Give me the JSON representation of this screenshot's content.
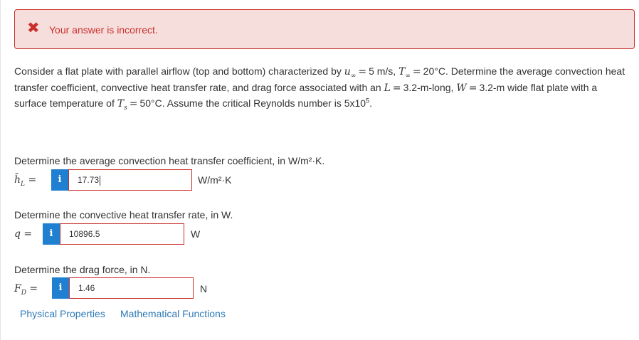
{
  "alert": {
    "icon": "x-icon",
    "message": "Your answer is incorrect.",
    "color": "#c9302c"
  },
  "problem": {
    "text_1": "Consider a flat plate with parallel airflow (top and bottom) characterized by",
    "u_var": "u",
    "u_sub": "∞",
    "eq": "=",
    "u_value": "5 m/s,",
    "t_var": "T",
    "t_sub": "∞",
    "t_value": "20°C. Determine the average convection heat transfer coefficient, convective heat transfer rate, and drag force associated with an",
    "l_var": "L",
    "l_value": "3.2-m-long,",
    "w_var": "W",
    "w_value": "3.2-m wide flat plate with a surface temperature of",
    "ts_var": "T",
    "ts_sub": "s",
    "ts_value": "50°C. Assume the critical Reynolds number is 5x10",
    "re_exp": "5",
    "end": "."
  },
  "questions": [
    {
      "prompt": "Determine the average convection heat transfer coefficient, in W/m²·K.",
      "var_main": "h̄",
      "var_sub": "L",
      "eq": "=",
      "info": "i",
      "value": "17.73",
      "unit": "W/m²·K"
    },
    {
      "prompt": "Determine the convective heat transfer rate, in W.",
      "var_main": "q",
      "var_sub": "",
      "eq": "=",
      "info": "i",
      "value": "10896.5",
      "unit": "W"
    },
    {
      "prompt": "Determine the drag force, in N.",
      "var_main": "F",
      "var_sub": "D",
      "eq": "=",
      "info": "i",
      "value": "1.46",
      "unit": "N"
    }
  ],
  "links": {
    "physical": "Physical Properties",
    "math": "Mathematical Functions"
  },
  "colors": {
    "error": "#c9302c",
    "error_bg": "#f6dedd",
    "info": "#1f7fd1",
    "link": "#2f7ab8"
  }
}
